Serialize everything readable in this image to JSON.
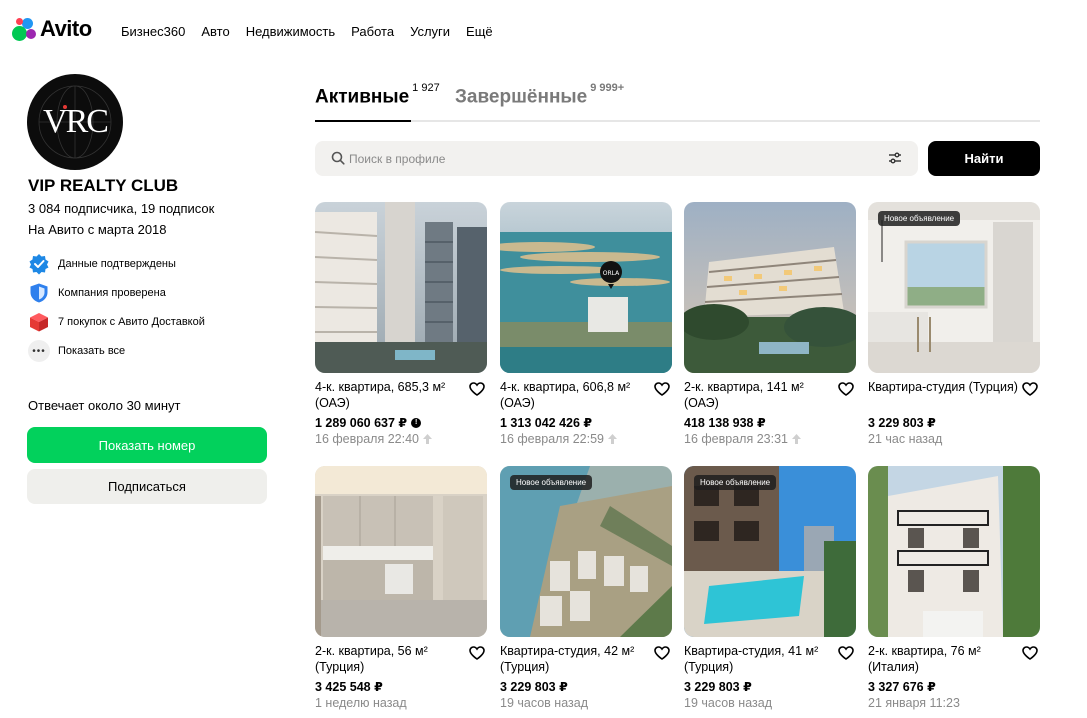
{
  "header": {
    "logo_text": "Avito",
    "nav": [
      "Бизнес360",
      "Авто",
      "Недвижимость",
      "Работа",
      "Услуги",
      "Ещё"
    ]
  },
  "profile": {
    "avatar_text": "VRC",
    "name": "VIP REALTY CLUB",
    "subscribers": "3 084 подписчика, 19 подписок",
    "since": "На Авито с марта 2018",
    "badges": [
      {
        "label": "Данные подтверждены",
        "icon": "verified-check-icon"
      },
      {
        "label": "Компания проверена",
        "icon": "shield-icon"
      },
      {
        "label": "7 покупок с Авито Доставкой",
        "icon": "box-icon"
      },
      {
        "label": "Показать все",
        "icon": "more-dots-icon"
      }
    ],
    "reply_time": "Отвечает около 30 минут",
    "phone_button": "Показать номер",
    "subscribe_button": "Подписаться"
  },
  "tabs": [
    {
      "label": "Активные",
      "count": "1 927"
    },
    {
      "label": "Завершённые",
      "count": "9 999+"
    }
  ],
  "search": {
    "placeholder": "Поиск в профиле",
    "button": "Найти"
  },
  "colors": {
    "accent_green": "#02d15c",
    "button_dark": "#000000",
    "muted_text": "#8a8a8a"
  },
  "listings": [
    {
      "title": "4-к. квартира, 685,3 м² (ОАЭ)",
      "price": "1 289 060 637 ₽",
      "date": "16 февраля 22:40",
      "badge": "",
      "raised": true,
      "price_info": true
    },
    {
      "title": "4-к. квартира, 606,8 м² (ОАЭ)",
      "price": "1 313 042 426 ₽",
      "date": "16 февраля 22:59",
      "badge": "",
      "raised": true,
      "price_info": false
    },
    {
      "title": "2-к. квартира, 141 м² (ОАЭ)",
      "price": "418 138 938 ₽",
      "date": "16 февраля 23:31",
      "badge": "",
      "raised": true,
      "price_info": false
    },
    {
      "title": "Квартира-студия (Турция)",
      "price": "3 229 803 ₽",
      "date": "21 час назад",
      "badge": "Новое объявление",
      "raised": false,
      "price_info": false
    },
    {
      "title": "2-к. квартира, 56 м² (Турция)",
      "price": "3 425 548 ₽",
      "date": "1 неделю назад",
      "badge": "",
      "raised": false,
      "price_info": false
    },
    {
      "title": "Квартира-студия, 42 м² (Турция)",
      "price": "3 229 803 ₽",
      "date": "19 часов назад",
      "badge": "Новое объявление",
      "raised": false,
      "price_info": false
    },
    {
      "title": "Квартира-студия, 41 м² (Турция)",
      "price": "3 229 803 ₽",
      "date": "19 часов назад",
      "badge": "Новое объявление",
      "raised": false,
      "price_info": false
    },
    {
      "title": "2-к. квартира, 76 м² (Италия)",
      "price": "3 327 676 ₽",
      "date": "21 января 11:23",
      "badge": "",
      "raised": false,
      "price_info": false
    }
  ]
}
